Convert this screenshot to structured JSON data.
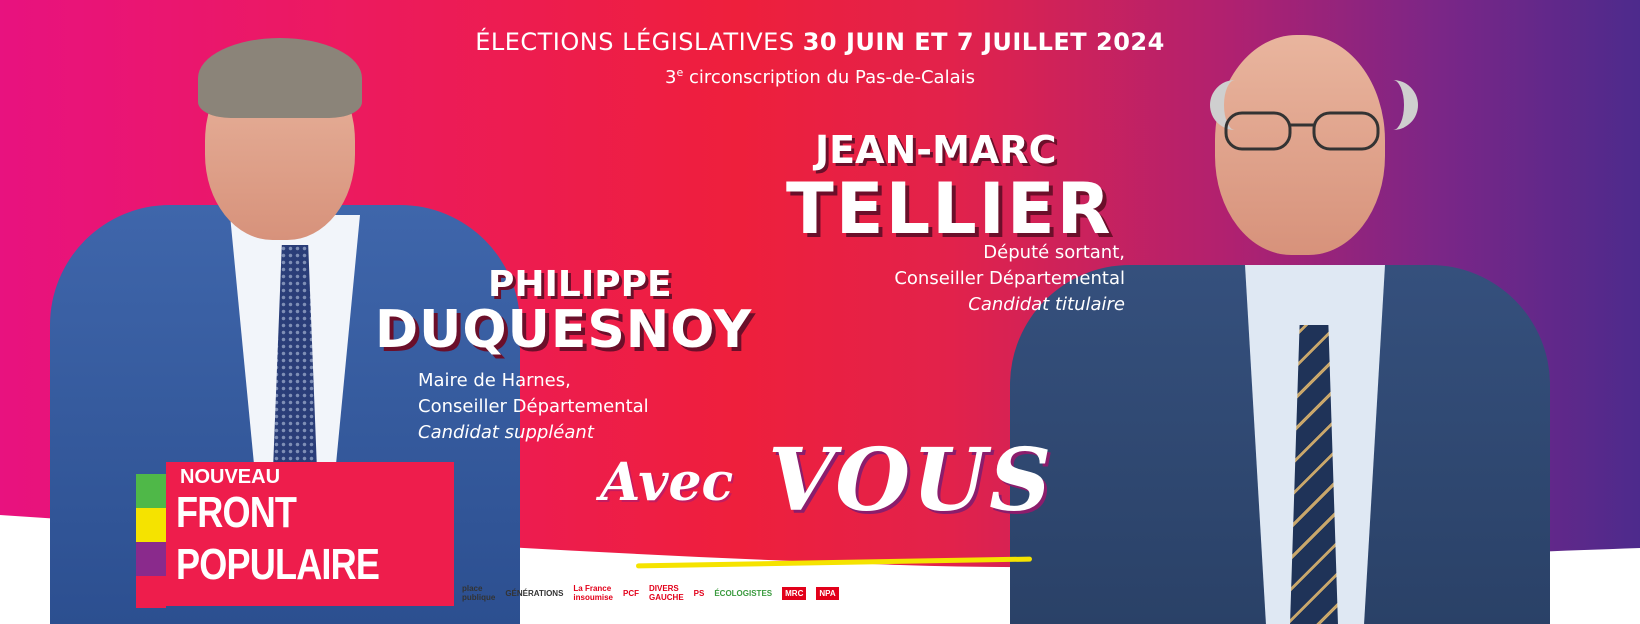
{
  "header": {
    "title_prefix": "ÉLECTIONS LÉGISLATIVES",
    "title_dates": "30 JUIN  ET 7 JUILLET 2024",
    "circ_number": "3",
    "circ_sup": "e",
    "circ_text": " circonscription du Pas-de-Calais"
  },
  "titulaire": {
    "first_name": "JEAN-MARC",
    "last_name": "TELLIER",
    "role1": "Député sortant,",
    "role2": "Conseiller Départemental",
    "role3": "Candidat titulaire"
  },
  "suppleant": {
    "first_name": "PHILIPPE",
    "last_name": "DUQUESNOY",
    "role1": "Maire de Harnes,",
    "role2": "Conseiller Départemental",
    "role3": "Candidat suppléant"
  },
  "slogan": {
    "avec": "Avec",
    "vous": "VOUS"
  },
  "nfp": {
    "line1": "NOUVEAU",
    "line2": "FRONT",
    "line3": "POPULAIRE"
  },
  "partners": {
    "place": "place\npublique",
    "generations": "GÉNÉRATIONS",
    "lfi": "La France\ninsoumise",
    "pcf": "PCF",
    "divers": "DIVERS\nGAUCHE",
    "ps": "PS",
    "ecolo": "ÉCOLOGISTES",
    "mrc": "MRC",
    "npa": "NPA"
  },
  "colors": {
    "gradient_left": "#e8127f",
    "gradient_mid": "#ee1f3c",
    "gradient_right": "#4d2a8c",
    "nfp_red": "#ee1d4c",
    "yellow": "#f5e300",
    "green": "#4fb848",
    "purple": "#8a2a8c"
  }
}
